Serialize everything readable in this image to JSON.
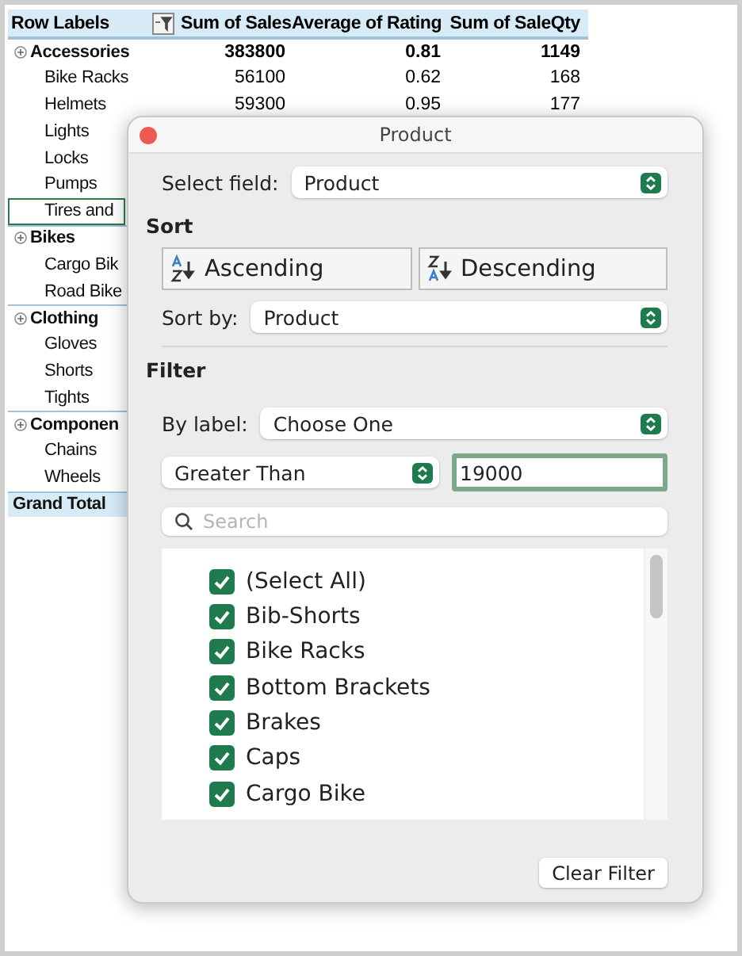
{
  "pivot": {
    "columns": [
      {
        "label": "Row Labels",
        "filter_active": true
      },
      {
        "label": "Sum of Sales"
      },
      {
        "label": "Average of Rating"
      },
      {
        "label": "Sum of SaleQty"
      }
    ],
    "rows": [
      {
        "kind": "group",
        "label": "Accessories",
        "values": [
          "383800",
          "0.81",
          "1149"
        ],
        "selected": false
      },
      {
        "kind": "item",
        "label": "Bike Racks",
        "values": [
          "56100",
          "0.62",
          "168"
        ],
        "selected": false
      },
      {
        "kind": "item",
        "label": "Helmets",
        "values": [
          "59300",
          "0.95",
          "177"
        ],
        "selected": false
      },
      {
        "kind": "item",
        "label": "Lights",
        "selected": false
      },
      {
        "kind": "item",
        "label": "Locks",
        "selected": false
      },
      {
        "kind": "item",
        "label": "Pumps",
        "selected": false
      },
      {
        "kind": "item",
        "label": "Tires and",
        "selected": true
      },
      {
        "kind": "group",
        "label": "Bikes",
        "selected": false
      },
      {
        "kind": "item",
        "label": "Cargo Bik",
        "selected": false
      },
      {
        "kind": "item",
        "label": "Road Bike",
        "selected": false
      },
      {
        "kind": "group",
        "label": "Clothing",
        "selected": false
      },
      {
        "kind": "item",
        "label": "Gloves",
        "selected": false
      },
      {
        "kind": "item",
        "label": "Shorts",
        "selected": false
      },
      {
        "kind": "item",
        "label": "Tights",
        "selected": false
      },
      {
        "kind": "group",
        "label": "Componen",
        "selected": false
      },
      {
        "kind": "item",
        "label": "Chains",
        "selected": false
      },
      {
        "kind": "item",
        "label": "Wheels",
        "selected": false
      },
      {
        "kind": "total",
        "label": "Grand Total",
        "selected": false
      }
    ]
  },
  "dialog": {
    "title": "Product",
    "select_field": {
      "label": "Select field:",
      "value": "Product"
    },
    "sort": {
      "heading": "Sort",
      "buttons": [
        {
          "kind": "ascending",
          "label": "Ascending"
        },
        {
          "kind": "descending",
          "label": "Descending"
        }
      ],
      "sort_by": {
        "label": "Sort by:",
        "value": "Product"
      }
    },
    "filter": {
      "heading": "Filter",
      "by_label": {
        "label": "By label:",
        "value": "Choose One"
      },
      "condition": {
        "value": "Greater Than"
      },
      "amount": {
        "value": "19000"
      },
      "search": {
        "placeholder": "Search"
      },
      "items": [
        {
          "label": "(Select All)",
          "checked": true
        },
        {
          "label": "Bib-Shorts",
          "checked": true
        },
        {
          "label": "Bike Racks",
          "checked": true
        },
        {
          "label": "Bottom Brackets",
          "checked": true
        },
        {
          "label": "Brakes",
          "checked": true
        },
        {
          "label": "Caps",
          "checked": true
        },
        {
          "label": "Cargo Bike",
          "checked": true
        }
      ]
    },
    "clear_button": "Clear Filter"
  }
}
